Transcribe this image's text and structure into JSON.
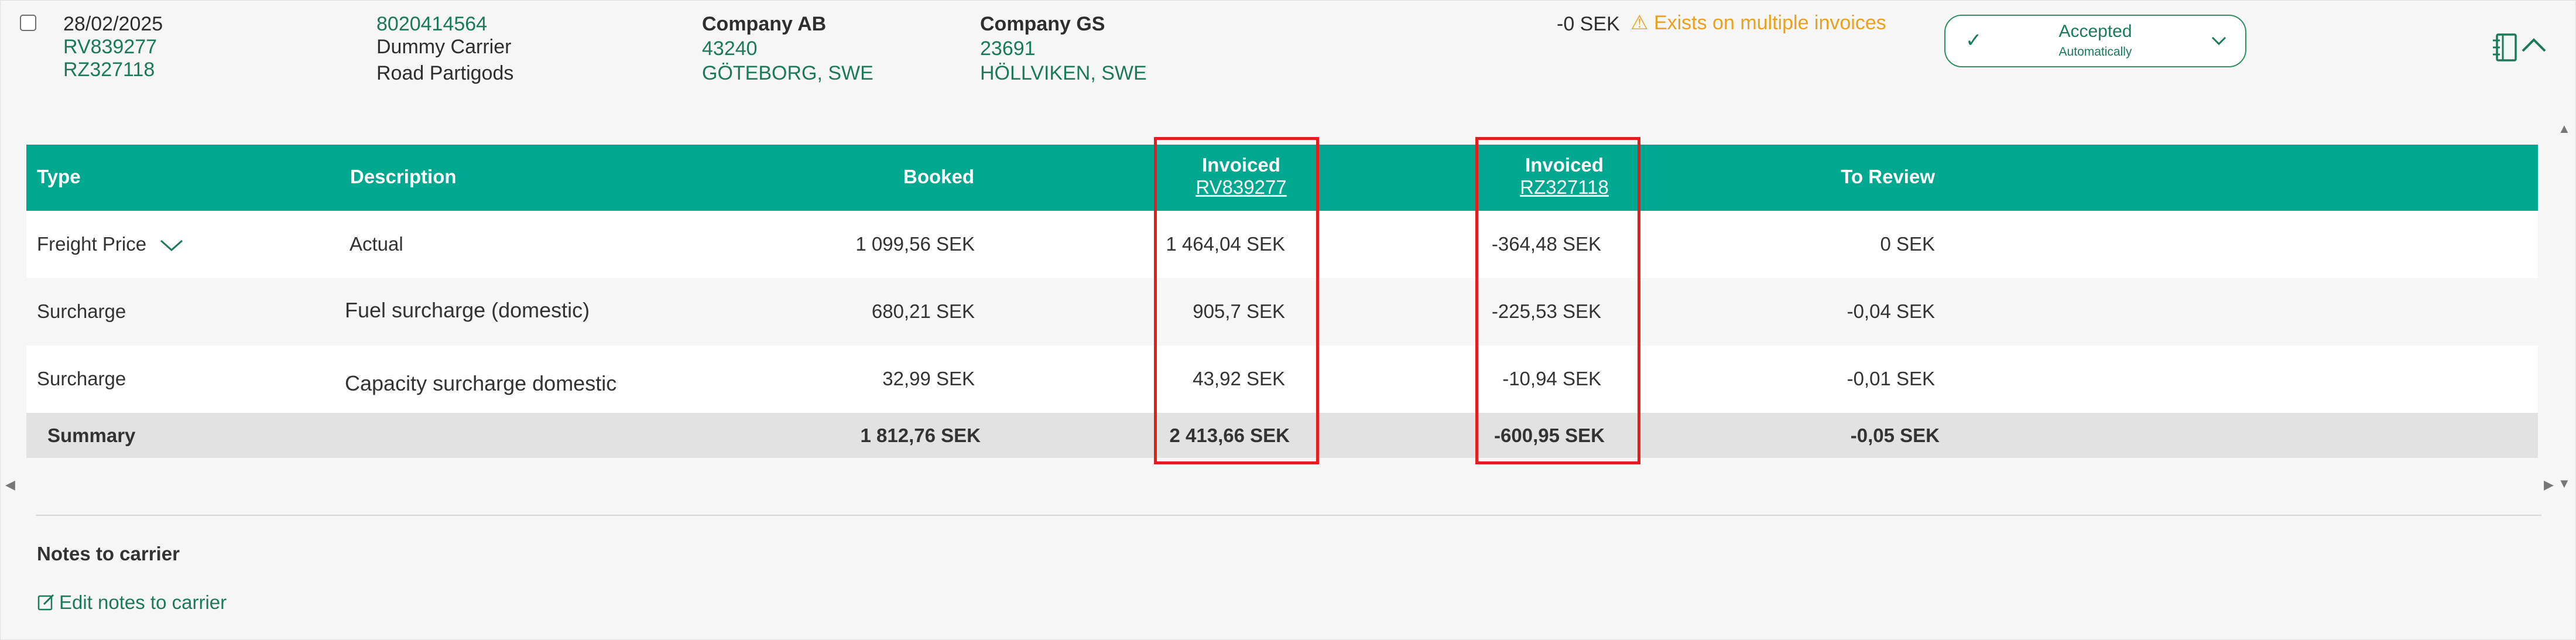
{
  "shipment": {
    "date": "28/02/2025",
    "refs": [
      "RV839277",
      "RZ327118"
    ],
    "shipment_number": "8020414564",
    "carrier": "Dummy Carrier",
    "mode": "Road Partigods",
    "consignor": {
      "name": "Company AB",
      "postal": "43240",
      "city": "GÖTEBORG, SWE"
    },
    "consignee": {
      "name": "Company GS",
      "postal": "23691",
      "city": "HÖLLVIKEN, SWE"
    },
    "diff_amount": "-0 SEK",
    "warning": "Exists on multiple invoices",
    "status": {
      "label": "Accepted",
      "sublabel": "Automatically"
    }
  },
  "table": {
    "headers": {
      "type": "Type",
      "description": "Description",
      "booked": "Booked",
      "invoiced1": {
        "label": "Invoiced",
        "ref": "RV839277"
      },
      "invoiced2": {
        "label": "Invoiced",
        "ref": "RZ327118"
      },
      "to_review": "To Review"
    },
    "rows": [
      {
        "type": "Freight Price",
        "description": "Actual",
        "booked": "1 099,56 SEK",
        "inv1": "1 464,04 SEK",
        "inv2": "-364,48 SEK",
        "review": "0 SEK"
      },
      {
        "type": "Surcharge",
        "description": "Fuel surcharge (domestic)",
        "booked": "680,21 SEK",
        "inv1": "905,7 SEK",
        "inv2": "-225,53 SEK",
        "review": "-0,04 SEK"
      },
      {
        "type": "Surcharge",
        "description": "Capacity surcharge domestic",
        "booked": "32,99 SEK",
        "inv1": "43,92 SEK",
        "inv2": "-10,94 SEK",
        "review": "-0,01 SEK"
      }
    ],
    "summary": {
      "label": "Summary",
      "booked": "1 812,76 SEK",
      "inv1": "2 413,66 SEK",
      "inv2": "-600,95 SEK",
      "review": "-0,05 SEK"
    }
  },
  "notes": {
    "title": "Notes to carrier",
    "edit_link": "Edit notes to carrier"
  },
  "colors": {
    "accent": "#00a88f",
    "highlight": "#e41e1e",
    "warning": "#e8a21f",
    "link": "#1b7a57"
  }
}
